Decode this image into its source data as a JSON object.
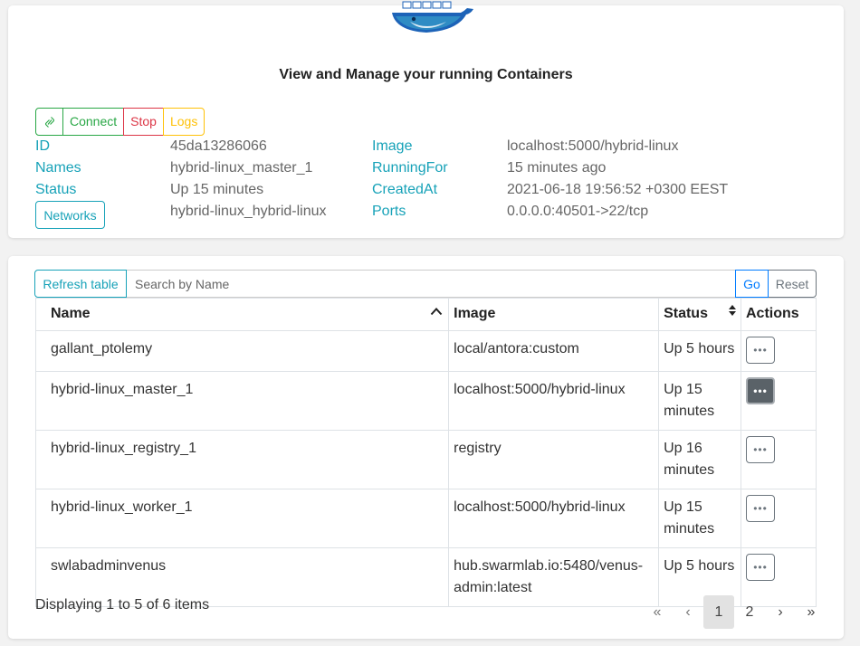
{
  "header": {
    "title": "View and Manage your running Containers",
    "logo_icon": "docker-whale-icon"
  },
  "container_actions": {
    "link_icon": "link-icon",
    "connect_label": "Connect",
    "stop_label": "Stop",
    "logs_label": "Logs"
  },
  "details": {
    "id_label": "ID",
    "id_value": "45da13286066",
    "names_label": "Names",
    "names_value": "hybrid-linux_master_1",
    "status_label": "Status",
    "status_value": "Up 15 minutes",
    "networks_label": "Networks",
    "networks_value": "hybrid-linux_hybrid-linux",
    "image_label": "Image",
    "image_value": "localhost:5000/hybrid-linux",
    "runningfor_label": "RunningFor",
    "runningfor_value": "15 minutes ago",
    "createdat_label": "CreatedAt",
    "createdat_value": "2021-06-18 19:56:52 +0300 EEST",
    "ports_label": "Ports",
    "ports_value": "0.0.0.0:40501->22/tcp"
  },
  "toolbar": {
    "refresh_label": "Refresh table",
    "search_placeholder": "Search by Name",
    "go_label": "Go",
    "reset_label": "Reset"
  },
  "table": {
    "headers": {
      "name": "Name",
      "image": "Image",
      "status": "Status",
      "actions": "Actions"
    },
    "rows": [
      {
        "name": "gallant_ptolemy",
        "image": "local/antora:custom",
        "status": "Up 5 hours"
      },
      {
        "name": "hybrid-linux_master_1",
        "image": "localhost:5000/hybrid-linux",
        "status": "Up 15 minutes"
      },
      {
        "name": "hybrid-linux_registry_1",
        "image": "registry",
        "status": "Up 16 minutes"
      },
      {
        "name": "hybrid-linux_worker_1",
        "image": "localhost:5000/hybrid-linux",
        "status": "Up 15 minutes"
      },
      {
        "name": "swlabadminvenus",
        "image": "hub.swarmlab.io:5480/venus-admin:latest",
        "status": "Up 5 hours"
      }
    ],
    "actions_glyph": "•••"
  },
  "footer": {
    "summary": "Displaying 1 to 5 of 6 items"
  },
  "pagination": {
    "first": "«",
    "prev": "‹",
    "pages": [
      "1",
      "2"
    ],
    "next": "›",
    "last": "»",
    "current": "1"
  },
  "colors": {
    "info": "#17a2b8",
    "success": "#28a745",
    "danger": "#dc3545",
    "warning": "#ffc107",
    "primary": "#007bff",
    "secondary": "#6c757d"
  }
}
